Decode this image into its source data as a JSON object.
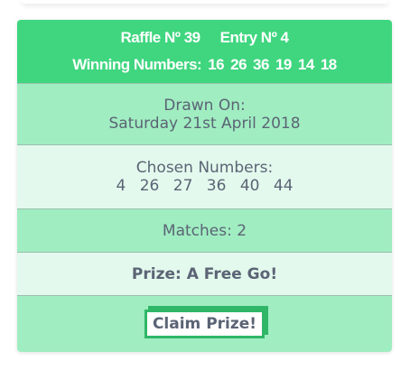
{
  "header": {
    "raffle_label": "Raffle Nº 39",
    "entry_label": "Entry Nº 4",
    "winning_label": "Winning Numbers:",
    "winning_numbers": [
      "16",
      "26",
      "36",
      "19",
      "14",
      "18"
    ]
  },
  "drawn": {
    "label": "Drawn On:",
    "date": "Saturday 21st April 2018"
  },
  "chosen": {
    "label": "Chosen Numbers:",
    "numbers": [
      "4",
      "26",
      "27",
      "36",
      "40",
      "44"
    ]
  },
  "matches": {
    "text": "Matches: 2"
  },
  "prize": {
    "text": "Prize: A Free Go!"
  },
  "claim": {
    "button_label": "Claim Prize!"
  },
  "colors": {
    "header_green": "#3fd67f",
    "row_dark": "#a0edc1",
    "row_light": "#e3f9ed",
    "text": "#5b6475",
    "button_border": "#2fb667"
  }
}
